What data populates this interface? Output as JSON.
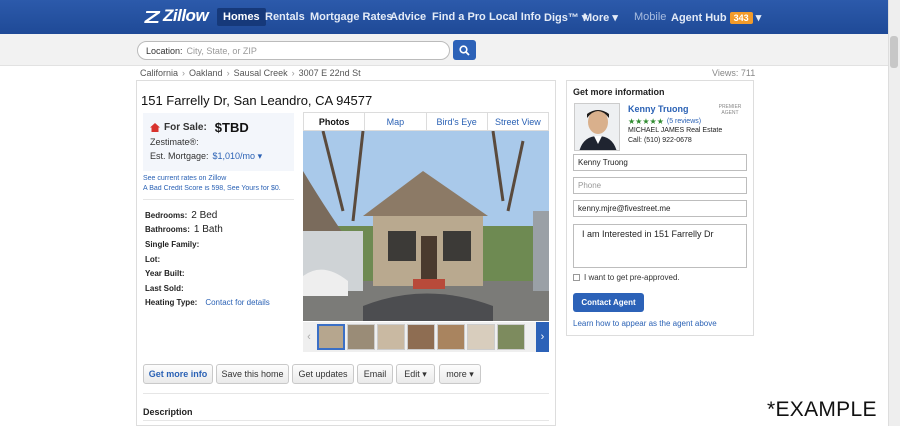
{
  "nav": {
    "logo": "Zillow",
    "items": [
      "Homes",
      "Rentals",
      "Mortgage Rates",
      "Advice",
      "Find a Pro",
      "Local Info",
      "Digs™",
      "More"
    ],
    "mobile": "Mobile",
    "agent_hub": "Agent Hub",
    "agent_hub_count": "343"
  },
  "search": {
    "label": "Location:",
    "placeholder": "City, State, or ZIP"
  },
  "breadcrumb": [
    "California",
    "Oakland",
    "Sausal Creek",
    "3007 E 22nd St"
  ],
  "views": "Views: 711",
  "listing": {
    "address": "151 Farrelly Dr, San Leandro, CA 94577",
    "for_sale_label": "For Sale:",
    "price": "$TBD",
    "zestimate_label": "Zestimate®:",
    "mortgage_label": "Est. Mortgage:",
    "mortgage_value": "$1,010/mo",
    "rates_link": "See current rates on Zillow",
    "credit_link": "A Bad Credit Score is 598, See Yours for $0.",
    "facts": [
      {
        "label": "Bedrooms:",
        "value": "2 Bed"
      },
      {
        "label": "Bathrooms:",
        "value": "1 Bath"
      },
      {
        "label": "Single Family:",
        "value": ""
      },
      {
        "label": "Lot:",
        "value": ""
      },
      {
        "label": "Year Built:",
        "value": ""
      },
      {
        "label": "Last Sold:",
        "value": ""
      },
      {
        "label": "Heating Type:",
        "link": "Contact for details"
      }
    ],
    "tabs": [
      "Photos",
      "Map",
      "Bird's Eye",
      "Street View"
    ],
    "actions": [
      "Get more info",
      "Save this home",
      "Get updates",
      "Email",
      "Edit",
      "more"
    ],
    "description_title": "Description"
  },
  "contact": {
    "title": "Get more information",
    "agent_name": "Kenny Truong",
    "premier": "PREMIER AGENT",
    "stars": "★★★★★",
    "reviews": "(5 reviews)",
    "brokerage": "MICHAEL JAMES Real Estate",
    "phone": "Call: (510) 922-0678",
    "name_value": "Kenny Truong",
    "phone_placeholder": "Phone",
    "email_value": "kenny.mjre@fivestreet.me",
    "message": "I am Interested in 151 Farrelly Dr",
    "preapproved": "I want to get pre-approved.",
    "button": "Contact Agent",
    "learn_link": "Learn how to appear as the agent above"
  },
  "watermark": "*EXAMPLE",
  "colors": {
    "nav_blue": "#2c5aab",
    "link_blue": "#2b62b5",
    "button_blue": "#2c62b8",
    "badge_orange": "#f29b2b"
  }
}
